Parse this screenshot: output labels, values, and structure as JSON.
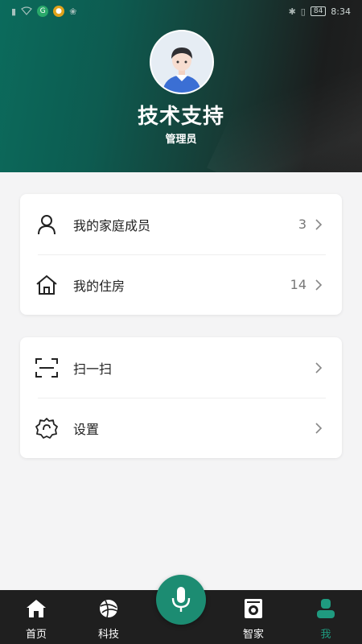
{
  "status_bar": {
    "time": "8:34",
    "battery": "84",
    "left_icons": [
      "sim-icon",
      "wifi-icon",
      "app-badge-icon",
      "coin-badge-icon",
      "paw-icon"
    ],
    "right_icons": [
      "bluetooth-icon",
      "vibrate-icon",
      "battery-icon"
    ]
  },
  "profile": {
    "name": "技术支持",
    "role": "管理员"
  },
  "menu_group1": [
    {
      "label": "我的家庭成员",
      "count": "3",
      "icon": "person-icon"
    },
    {
      "label": "我的住房",
      "count": "14",
      "icon": "home-icon"
    }
  ],
  "menu_group2": [
    {
      "label": "扫一扫",
      "icon": "scan-icon"
    },
    {
      "label": "设置",
      "icon": "settings-icon"
    }
  ],
  "tabbar": {
    "tabs": [
      {
        "label": "首页",
        "icon": "home-icon"
      },
      {
        "label": "科技",
        "icon": "globe-icon"
      },
      {
        "label": "智家",
        "icon": "washer-icon"
      },
      {
        "label": "我",
        "icon": "user-icon"
      }
    ],
    "active": "我",
    "mic_icon": "microphone-icon"
  },
  "colors": {
    "accent": "#1f9a7f",
    "mic": "#1c8c72",
    "tabbar_bg": "#1f1f1f"
  }
}
